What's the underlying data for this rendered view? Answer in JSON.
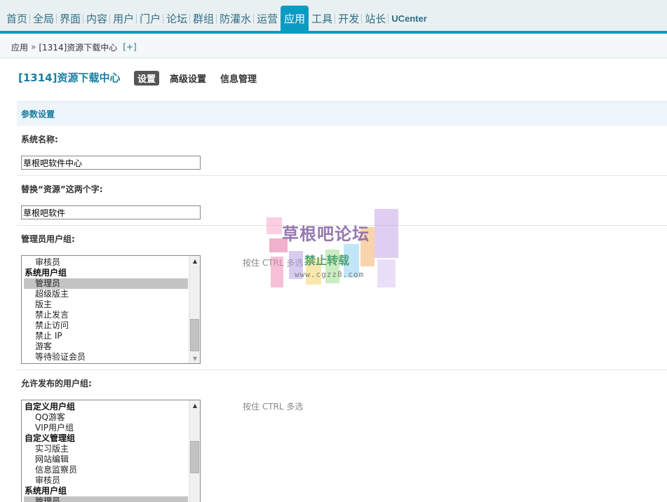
{
  "nav": {
    "items": [
      {
        "label": "首页"
      },
      {
        "label": "全局"
      },
      {
        "label": "界面"
      },
      {
        "label": "内容"
      },
      {
        "label": "用户"
      },
      {
        "label": "门户"
      },
      {
        "label": "论坛"
      },
      {
        "label": "群组"
      },
      {
        "label": "防灌水"
      },
      {
        "label": "运营"
      },
      {
        "label": "应用",
        "active": true
      },
      {
        "label": "工具"
      },
      {
        "label": "开发"
      },
      {
        "label": "站长"
      },
      {
        "label": "UCenter"
      }
    ]
  },
  "breadcrumb": {
    "root": "应用",
    "sep": "»",
    "current": "[1314]资源下载中心",
    "add": "[+]"
  },
  "page": {
    "title": "[1314]资源下载中心",
    "tabs": [
      "设置",
      "高级设置",
      "信息管理"
    ],
    "section_title": "参数设置"
  },
  "form": {
    "system_name_label": "系统名称:",
    "system_name_value": "草根吧软件中心",
    "replace_label": "替换“资源”这两个字:",
    "replace_value": "草根吧软件",
    "admin_groups_label": "管理员用户组:",
    "admin_groups_tip": "按住 CTRL 多选",
    "admin_groups_items": [
      {
        "text": "审核员",
        "group": false,
        "selected": false
      },
      {
        "text": "系统用户组",
        "group": true,
        "selected": false
      },
      {
        "text": "管理员",
        "group": false,
        "selected": true
      },
      {
        "text": "超级版主",
        "group": false,
        "selected": false
      },
      {
        "text": "版主",
        "group": false,
        "selected": false
      },
      {
        "text": "禁止发言",
        "group": false,
        "selected": false
      },
      {
        "text": "禁止访问",
        "group": false,
        "selected": false
      },
      {
        "text": "禁止 IP",
        "group": false,
        "selected": false
      },
      {
        "text": "游客",
        "group": false,
        "selected": false
      },
      {
        "text": "等待验证会员",
        "group": false,
        "selected": false
      }
    ],
    "post_groups_label": "允许发布的用户组:",
    "post_groups_tip": "按住 CTRL 多选",
    "post_groups_items": [
      {
        "text": "自定义用户组",
        "group": true,
        "selected": false
      },
      {
        "text": "QQ游客",
        "group": false,
        "selected": false
      },
      {
        "text": "VIP用户组",
        "group": false,
        "selected": false
      },
      {
        "text": "自定义管理组",
        "group": true,
        "selected": false
      },
      {
        "text": "实习版主",
        "group": false,
        "selected": false
      },
      {
        "text": "网站编辑",
        "group": false,
        "selected": false
      },
      {
        "text": "信息监察员",
        "group": false,
        "selected": false
      },
      {
        "text": "审核员",
        "group": false,
        "selected": false
      },
      {
        "text": "系统用户组",
        "group": true,
        "selected": false
      },
      {
        "text": "管理员",
        "group": false,
        "selected": true
      }
    ]
  },
  "watermark": {
    "line1": "草根吧论坛",
    "line2": "禁止转载",
    "line3": "www.cgzz8.com"
  },
  "colors": {
    "accent": "#0a9bc3",
    "title": "#1a7fa1"
  }
}
